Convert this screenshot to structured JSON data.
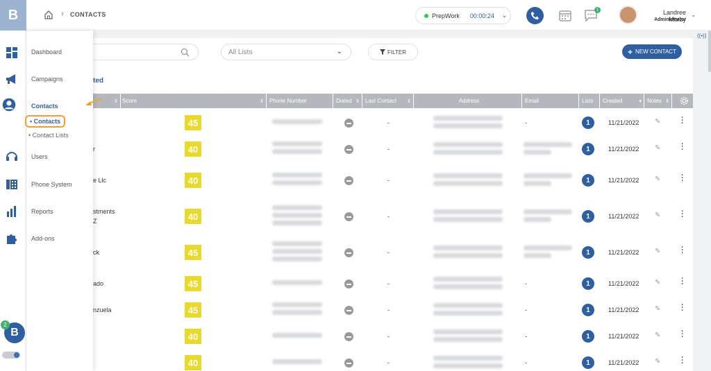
{
  "app": {
    "logo": "B"
  },
  "breadcrumb": {
    "page": "CONTACTS"
  },
  "timer": {
    "label": "PrepWork",
    "time": "00:00:24"
  },
  "messages_badge": "1",
  "user": {
    "name": "Landree Morby",
    "role": "Administrator"
  },
  "rail_badge": "2",
  "nav": {
    "dashboard": "Dashboard",
    "campaigns": "Campaigns",
    "contacts": "Contacts",
    "contacts_sub": "• Contacts",
    "contact_lists_sub": "• Contact Lists",
    "users": "Users",
    "phone_system": "Phone System",
    "reports": "Reports",
    "addons": "Add-ons"
  },
  "toolbar": {
    "lists_placeholder": "All Lists",
    "filter": "FILTER",
    "new_contact": "NEW CONTACT"
  },
  "section_title": "ted",
  "columns": {
    "score": "Score",
    "phone": "Phone Number",
    "dialed": "Dialed",
    "last_contact": "Last Contact",
    "address": "Address",
    "email": "Email",
    "lists": "Lists",
    "created": "Created",
    "notes": "Notes"
  },
  "rows": [
    {
      "name": "",
      "score": "45",
      "last": "-",
      "email_dash": "-",
      "lists": "1",
      "created": "11/21/2022"
    },
    {
      "name": "r",
      "score": "40",
      "last": "-",
      "email_dash": "",
      "lists": "1",
      "created": "11/21/2022"
    },
    {
      "name": "e Llc",
      "score": "40",
      "last": "-",
      "email_dash": "",
      "lists": "1",
      "created": "11/21/2022"
    },
    {
      "name": "stments",
      "name2": "Z",
      "score": "40",
      "last": "-",
      "email_dash": "",
      "lists": "1",
      "created": "11/21/2022"
    },
    {
      "name": "ck",
      "score": "45",
      "last": "-",
      "email_dash": "",
      "lists": "1",
      "created": "11/21/2022"
    },
    {
      "name": "ado",
      "score": "45",
      "last": "-",
      "email_dash": "-",
      "lists": "1",
      "created": "11/21/2022"
    },
    {
      "name": "nzuela",
      "score": "45",
      "last": "-",
      "email_dash": "-",
      "lists": "1",
      "created": "11/21/2022"
    },
    {
      "name": "",
      "score": "40",
      "last": "-",
      "email_dash": "-",
      "lists": "1",
      "created": "11/21/2022"
    },
    {
      "name": "",
      "score": "40",
      "last": "-",
      "email_dash": "-",
      "lists": "1",
      "created": "11/21/2022"
    }
  ]
}
